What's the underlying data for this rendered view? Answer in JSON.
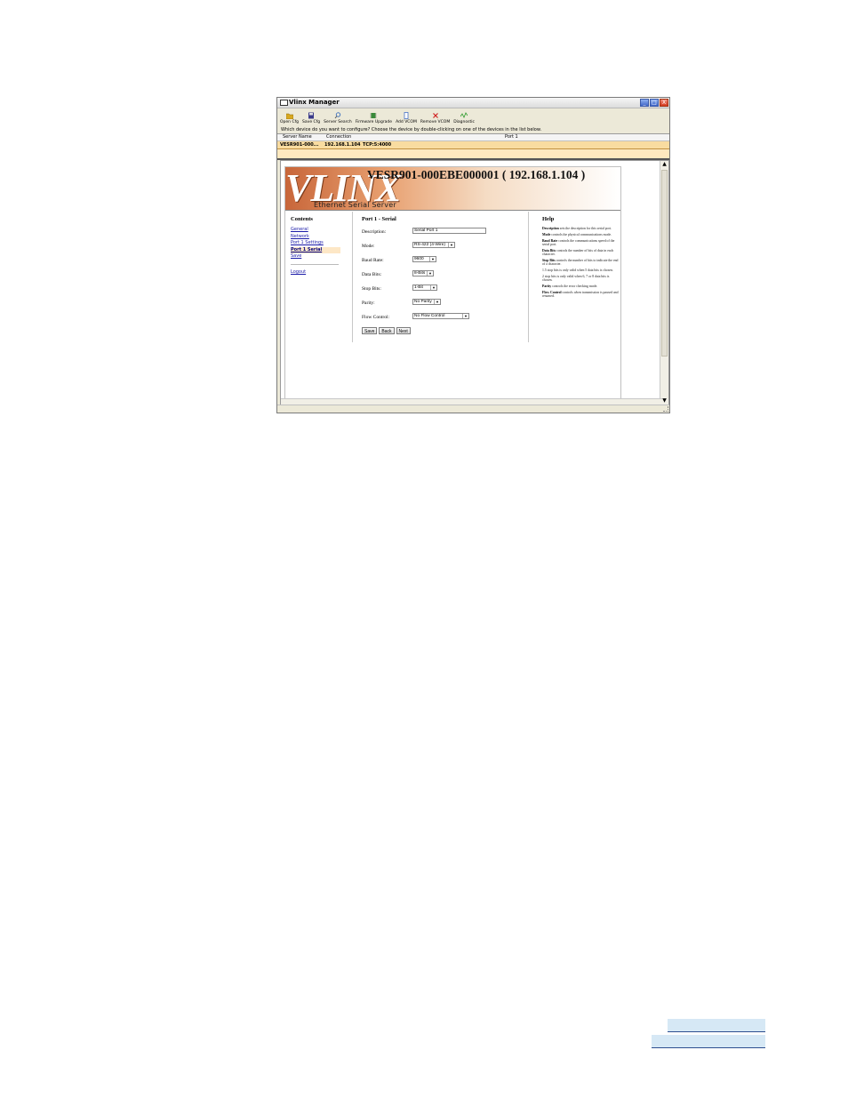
{
  "window": {
    "title": "Vlinx Manager",
    "buttons": [
      "_",
      "□",
      "X"
    ]
  },
  "toolbar": [
    {
      "label": "Open Cfg",
      "icon": "folder-icon",
      "color": "#d8a820"
    },
    {
      "label": "Save Cfg",
      "icon": "floppy-icon",
      "color": "#3a3a8a"
    },
    {
      "label": "Server Search",
      "icon": "magnifier-icon",
      "color": "#4a7ac0"
    },
    {
      "label": "Firmware Upgrade",
      "icon": "chip-icon",
      "color": "#3a8a3a"
    },
    {
      "label": "Add VCOM",
      "icon": "add-vcom-icon",
      "color": "#3060c0"
    },
    {
      "label": "Remove VCOM",
      "icon": "remove-icon",
      "color": "#d02020"
    },
    {
      "label": "Diagnostic",
      "icon": "diagnostic-icon",
      "color": "#2a9a2a"
    }
  ],
  "prompt": "Which device do you want to configure? Choose the device by double-clicking on one of the devices in the list below.",
  "device_list": {
    "headers": [
      "Server Name",
      "Connection",
      "Port 1"
    ],
    "rows": [
      {
        "server": "VESR901-000...",
        "ip": "192.168.1.104",
        "port": "TCP:5:4000"
      }
    ]
  },
  "banner": {
    "logo": "VLINX",
    "device_title": "VESR901-000EBE000001 ( 192.168.1.104 )",
    "tagline": "Ethernet Serial Server"
  },
  "sidebar": {
    "heading": "Contents",
    "links": [
      "General",
      "Network",
      "Port 1 Settings",
      "Port 1 Serial",
      "Save"
    ],
    "active_index": 3,
    "logout": "Logout"
  },
  "form": {
    "heading": "Port 1 - Serial",
    "description_label": "Description:",
    "description_value": "Serial Port 1",
    "mode_label": "Mode:",
    "mode_value": "RS-422 (4-Wire)",
    "baud_label": "Baud Rate:",
    "baud_value": "9600",
    "databits_label": "Data Bits:",
    "databits_value": "8-Bits",
    "stopbits_label": "Stop Bits:",
    "stopbits_value": "1-Bit",
    "parity_label": "Parity:",
    "parity_value": "No Parity",
    "flow_label": "Flow Control:",
    "flow_value": "No Flow Control",
    "save_label": "Save",
    "back_label": "Back",
    "next_label": "Next"
  },
  "help": {
    "heading": "Help",
    "items": [
      {
        "term": "Description",
        "text": " sets the description for this serial port."
      },
      {
        "term": "Mode",
        "text": " controls the physical communications mode."
      },
      {
        "term": "Baud Rate",
        "text": " controls the communications speed of the serial port."
      },
      {
        "term": "Data Bits",
        "text": " controls the number of bits of data in each character."
      },
      {
        "term": "Stop Bits",
        "text": " controls the number of bits to indicate the end of a character."
      },
      {
        "term": "",
        "text": "1.5 stop bits is only valid when 5 data bits is chosen."
      },
      {
        "term": "",
        "text": "2 stop bits is only valid when 6, 7 or 8 data bits is chosen."
      },
      {
        "term": "Parity",
        "text": " controls the error checking mode."
      },
      {
        "term": "Flow Control",
        "text": " controls when transmission is paused and resumed."
      }
    ]
  }
}
